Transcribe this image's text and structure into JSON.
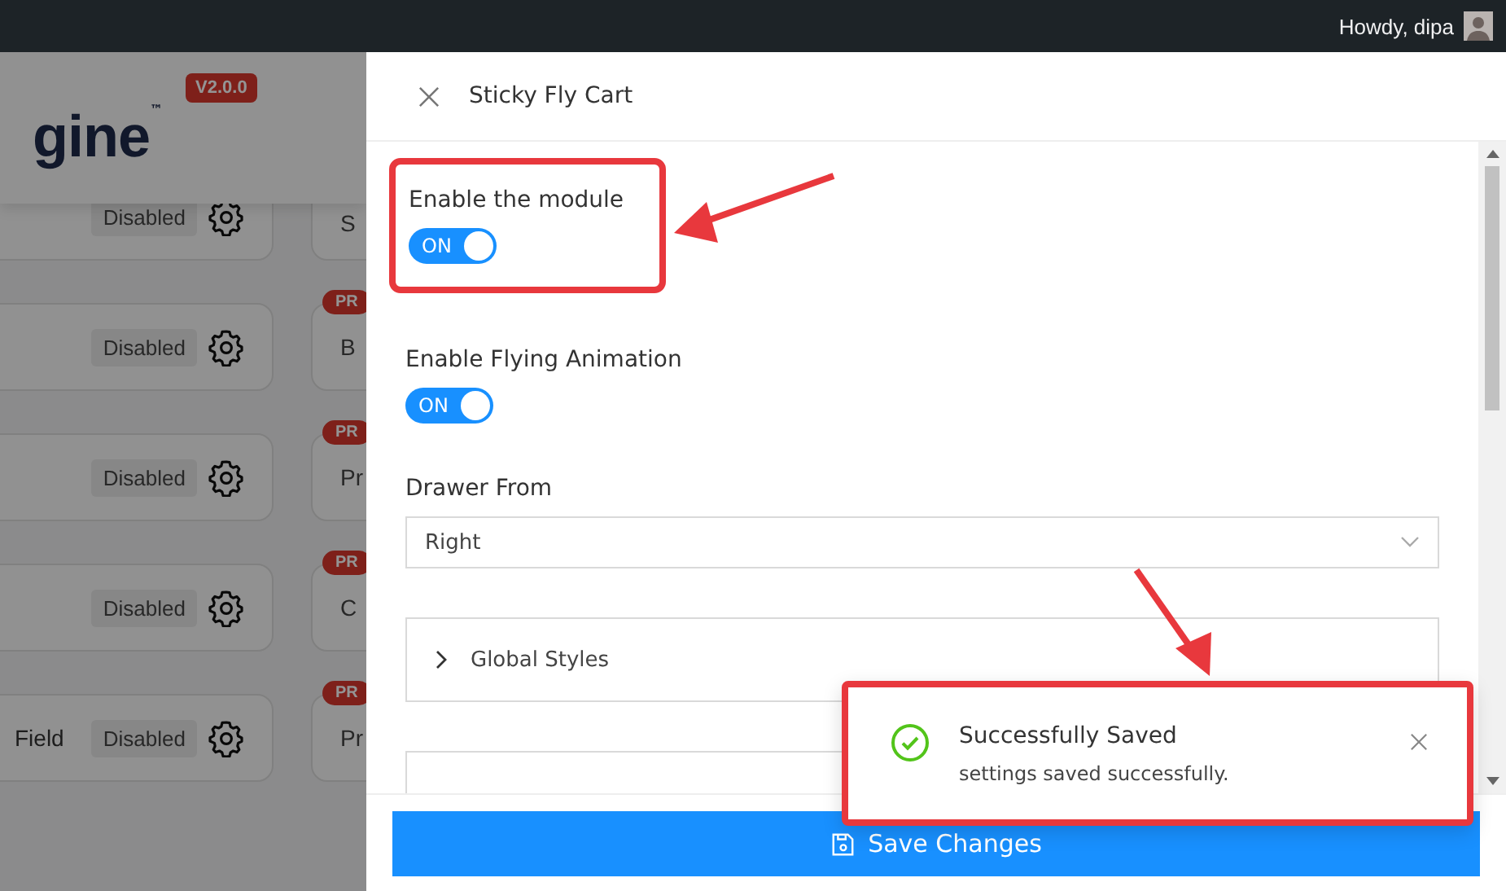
{
  "admin_bar": {
    "greeting": "Howdy, dipa"
  },
  "background": {
    "logo": "gine",
    "trademark": "™",
    "version": "V2.0.0",
    "module_rows": [
      {
        "left": {
          "status": "Disabled"
        },
        "right": {
          "name": "S"
        }
      },
      {
        "left": {
          "status": "Disabled"
        },
        "right": {
          "name": "B",
          "badge": "PR"
        }
      },
      {
        "left": {
          "status": "Disabled"
        },
        "right": {
          "name": "Pr",
          "badge": "PR"
        }
      },
      {
        "left": {
          "status": "Disabled"
        },
        "right": {
          "name": "C",
          "badge": "PR"
        }
      },
      {
        "left": {
          "name": "Field",
          "status": "Disabled"
        },
        "right": {
          "name": "Pr",
          "badge": "PR"
        }
      }
    ]
  },
  "drawer": {
    "title": "Sticky Fly Cart",
    "fields": [
      {
        "kind": "toggle",
        "label": "Enable the module",
        "on": true,
        "toggle_text": "ON",
        "highlighted": true
      },
      {
        "kind": "toggle",
        "label": "Enable Flying Animation",
        "on": true,
        "toggle_text": "ON"
      },
      {
        "kind": "select",
        "label": "Drawer From",
        "value": "Right"
      },
      {
        "kind": "accordion",
        "label": "Global Styles",
        "expanded": false
      }
    ],
    "save_button": "Save Changes"
  },
  "toast": {
    "title": "Successfully Saved",
    "message": "settings saved successfully.",
    "highlighted": true
  }
}
